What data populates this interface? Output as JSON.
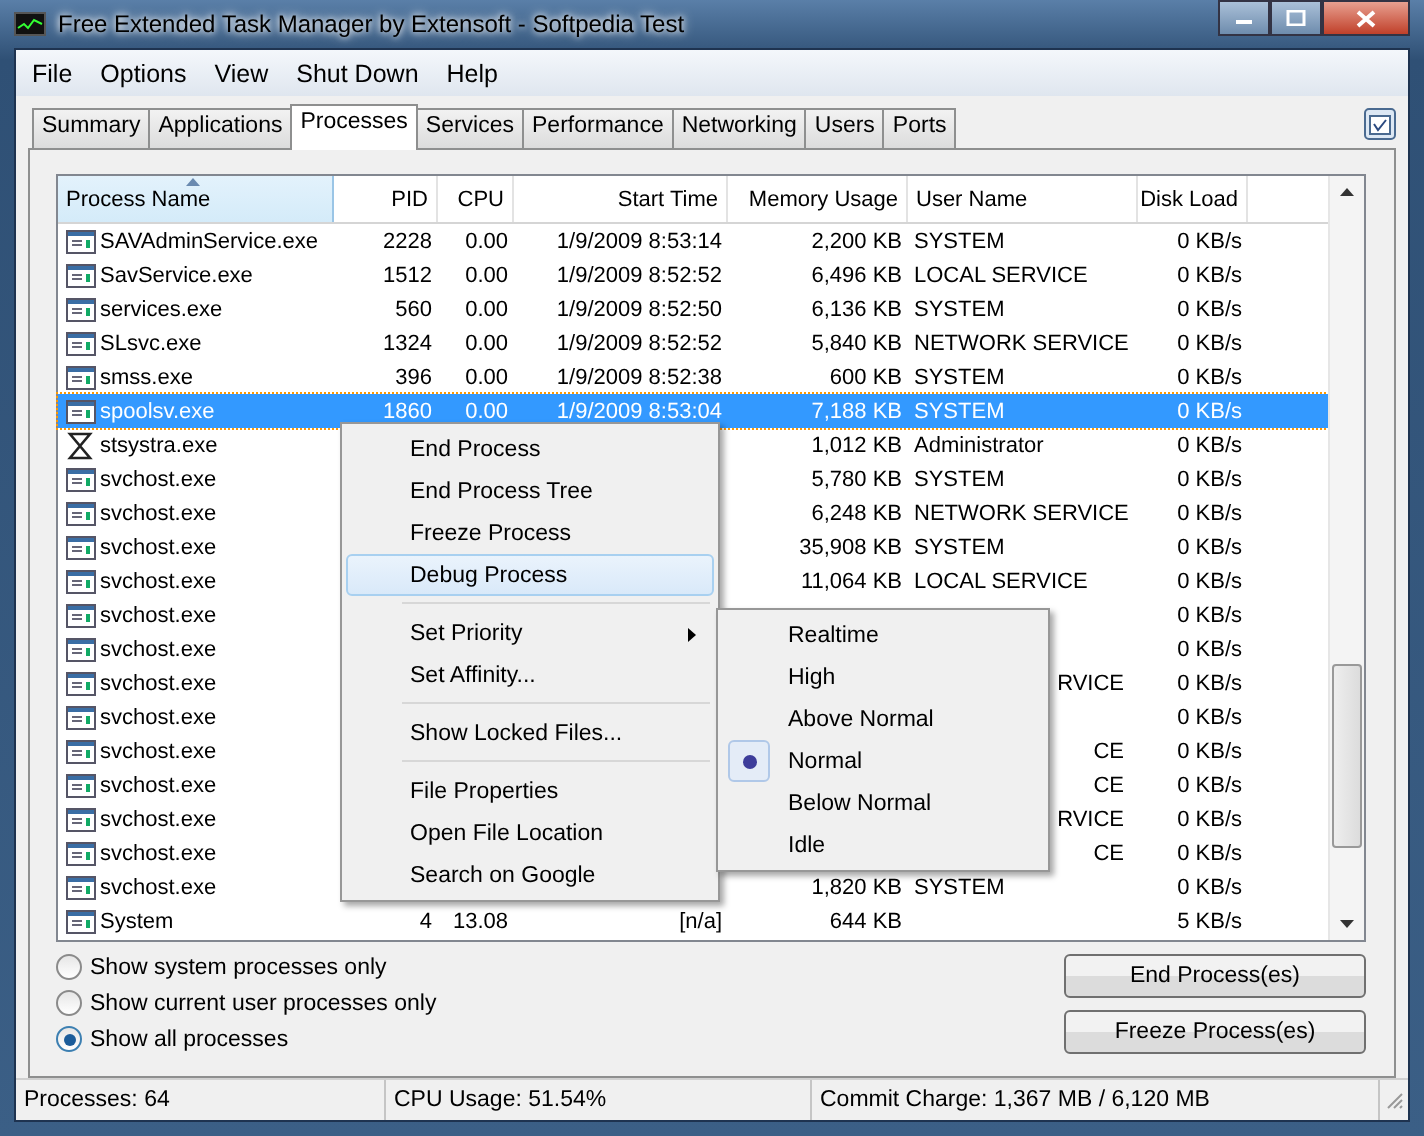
{
  "window": {
    "title": "Free Extended Task Manager by Extensoft - Softpedia Test"
  },
  "menu": [
    "File",
    "Options",
    "View",
    "Shut Down",
    "Help"
  ],
  "tabs": [
    {
      "label": "Summary",
      "selected": false
    },
    {
      "label": "Applications",
      "selected": false
    },
    {
      "label": "Processes",
      "selected": true
    },
    {
      "label": "Services",
      "selected": false
    },
    {
      "label": "Performance",
      "selected": false
    },
    {
      "label": "Networking",
      "selected": false
    },
    {
      "label": "Users",
      "selected": false
    },
    {
      "label": "Ports",
      "selected": false
    }
  ],
  "table": {
    "columns": [
      "Process Name",
      "PID",
      "CPU",
      "Start Time",
      "Memory Usage",
      "User Name",
      "Disk Load"
    ],
    "rows": [
      {
        "kind": "app",
        "name": "SAVAdminService.exe",
        "pid": "2228",
        "cpu": "0.00",
        "start": "1/9/2009 8:53:14",
        "memory": "2,200 KB",
        "user": "SYSTEM",
        "disk": "0 KB/s",
        "selected": false
      },
      {
        "kind": "app",
        "name": "SavService.exe",
        "pid": "1512",
        "cpu": "0.00",
        "start": "1/9/2009 8:52:52",
        "memory": "6,496 KB",
        "user": "LOCAL SERVICE",
        "disk": "0 KB/s",
        "selected": false
      },
      {
        "kind": "app",
        "name": "services.exe",
        "pid": "560",
        "cpu": "0.00",
        "start": "1/9/2009 8:52:50",
        "memory": "6,136 KB",
        "user": "SYSTEM",
        "disk": "0 KB/s",
        "selected": false
      },
      {
        "kind": "app",
        "name": "SLsvc.exe",
        "pid": "1324",
        "cpu": "0.00",
        "start": "1/9/2009 8:52:52",
        "memory": "5,840 KB",
        "user": "NETWORK SERVICE",
        "disk": "0 KB/s",
        "selected": false
      },
      {
        "kind": "app",
        "name": "smss.exe",
        "pid": "396",
        "cpu": "0.00",
        "start": "1/9/2009 8:52:38",
        "memory": "600 KB",
        "user": "SYSTEM",
        "disk": "0 KB/s",
        "selected": false
      },
      {
        "kind": "app",
        "name": "spoolsv.exe",
        "pid": "1860",
        "cpu": "0.00",
        "start": "1/9/2009 8:53:04",
        "memory": "7,188 KB",
        "user": "SYSTEM",
        "disk": "0 KB/s",
        "selected": true
      },
      {
        "kind": "hourglass",
        "name": "stsystra.exe",
        "memory": "1,012 KB",
        "user": "Administrator",
        "disk": "0 KB/s",
        "selected": false
      },
      {
        "kind": "app",
        "name": "svchost.exe",
        "memory": "5,780 KB",
        "user": "SYSTEM",
        "disk": "0 KB/s",
        "selected": false
      },
      {
        "kind": "app",
        "name": "svchost.exe",
        "memory": "6,248 KB",
        "user": "NETWORK SERVICE",
        "disk": "0 KB/s",
        "selected": false
      },
      {
        "kind": "app",
        "name": "svchost.exe",
        "memory": "35,908 KB",
        "user": "SYSTEM",
        "disk": "0 KB/s",
        "selected": false
      },
      {
        "kind": "app",
        "name": "svchost.exe",
        "memory": "11,064 KB",
        "user": "LOCAL SERVICE",
        "disk": "0 KB/s",
        "selected": false
      },
      {
        "kind": "app",
        "name": "svchost.exe",
        "disk": "0 KB/s",
        "selected": false
      },
      {
        "kind": "app",
        "name": "svchost.exe",
        "disk": "0 KB/s",
        "selected": false
      },
      {
        "kind": "app",
        "name": "svchost.exe",
        "user_tail": "RVICE",
        "disk": "0 KB/s",
        "selected": false
      },
      {
        "kind": "app",
        "name": "svchost.exe",
        "disk": "0 KB/s",
        "selected": false
      },
      {
        "kind": "app",
        "name": "svchost.exe",
        "user_tail": "CE",
        "disk": "0 KB/s",
        "selected": false
      },
      {
        "kind": "app",
        "name": "svchost.exe",
        "user_tail": "CE",
        "disk": "0 KB/s",
        "selected": false
      },
      {
        "kind": "app",
        "name": "svchost.exe",
        "user_tail": "RVICE",
        "disk": "0 KB/s",
        "selected": false
      },
      {
        "kind": "app",
        "name": "svchost.exe",
        "user_tail": "CE",
        "disk": "0 KB/s",
        "selected": false
      },
      {
        "kind": "app",
        "name": "svchost.exe",
        "memory": "1,820 KB",
        "user": "SYSTEM",
        "disk": "0 KB/s",
        "selected": false
      },
      {
        "kind": "app",
        "name": "System",
        "pid": "4",
        "cpu": "13.08",
        "start": "[n/a]",
        "memory": "644 KB",
        "disk": "5 KB/s",
        "selected": false
      }
    ]
  },
  "context_menu": [
    {
      "kind": "item",
      "label": "End Process",
      "highlighted": false
    },
    {
      "kind": "item",
      "label": "End Process Tree",
      "highlighted": false
    },
    {
      "kind": "item",
      "label": "Freeze Process",
      "highlighted": false
    },
    {
      "kind": "item",
      "label": "Debug Process",
      "highlighted": true
    },
    {
      "kind": "separator"
    },
    {
      "kind": "submenu",
      "label": "Set Priority",
      "highlighted": false
    },
    {
      "kind": "item",
      "label": "Set Affinity...",
      "highlighted": false
    },
    {
      "kind": "separator"
    },
    {
      "kind": "item",
      "label": "Show Locked Files...",
      "highlighted": false
    },
    {
      "kind": "separator"
    },
    {
      "kind": "item",
      "label": "File Properties",
      "highlighted": false
    },
    {
      "kind": "item",
      "label": "Open File Location",
      "highlighted": false
    },
    {
      "kind": "item",
      "label": "Search on Google",
      "highlighted": false
    }
  ],
  "priority_submenu": [
    {
      "label": "Realtime",
      "selected": false
    },
    {
      "label": "High",
      "selected": false
    },
    {
      "label": "Above Normal",
      "selected": false
    },
    {
      "label": "Normal",
      "selected": true
    },
    {
      "label": "Below Normal",
      "selected": false
    },
    {
      "label": "Idle",
      "selected": false
    }
  ],
  "filters": [
    {
      "label": "Show system processes only",
      "selected": false
    },
    {
      "label": "Show current user processes only",
      "selected": false
    },
    {
      "label": "Show all processes",
      "selected": true
    }
  ],
  "buttons": [
    "End Process(es)",
    "Freeze Process(es)"
  ],
  "status_bar": [
    "Processes: 64",
    "CPU Usage: 51.54%",
    "Commit Charge: 1,367 MB / 6,120 MB"
  ]
}
